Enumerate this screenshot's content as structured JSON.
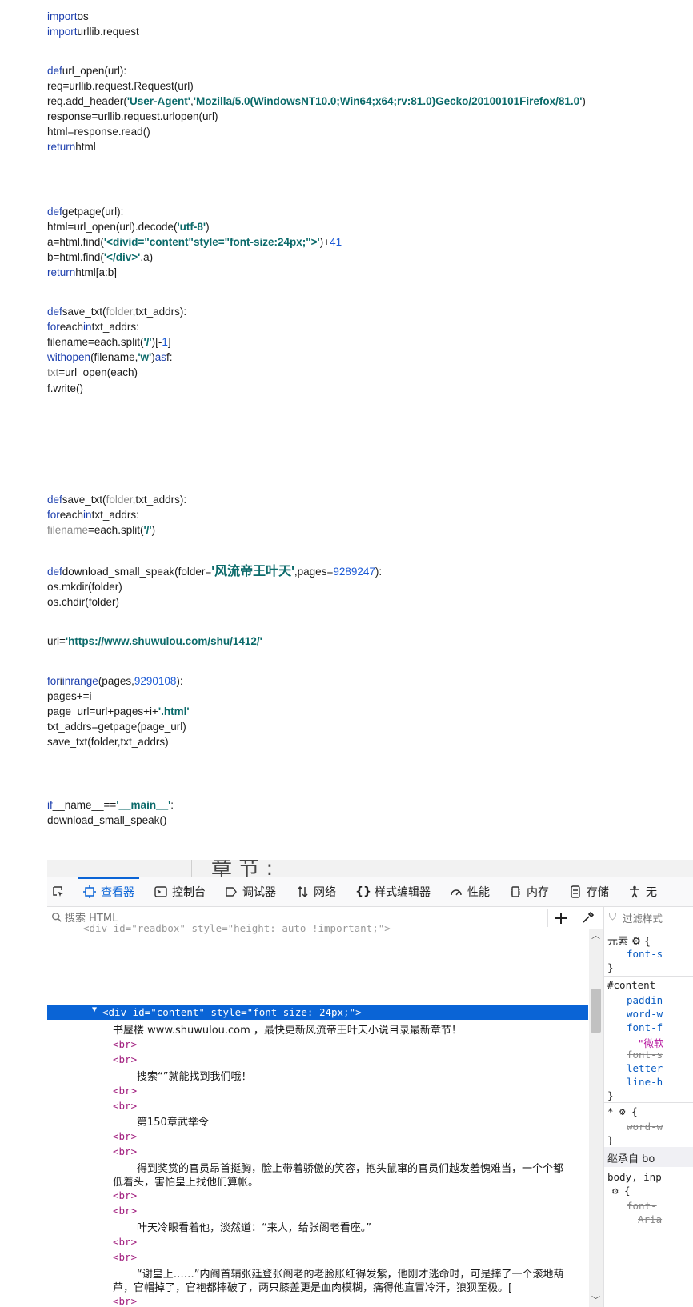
{
  "code": {
    "l1": {
      "kw": "import",
      "rest": "os"
    },
    "l2": {
      "kw": "import",
      "rest": "urllib.request"
    },
    "l3": {
      "kw": "def",
      "rest": "url_open(url):"
    },
    "l4": "req=urllib.request.Request(url)",
    "l5": {
      "pre": "req.add_header(",
      "s1": "'User-Agent'",
      "mid": ",",
      "s2": "'Mozilla/5.0(WindowsNT10.0;Win64;x64;rv:81.0)Gecko/20100101Firefox/81.0'",
      "post": ")"
    },
    "l6": "response=urllib.request.urlopen(url)",
    "l7": "html=response.read()",
    "l8": {
      "kw": "return",
      "rest": "html"
    },
    "l9": {
      "kw": "def",
      "rest": "getpage(url):"
    },
    "l10": {
      "pre": "html=url_open(url).decode(",
      "s": "'utf-8'",
      "post": ")"
    },
    "l11": {
      "pre": "a=html.find(",
      "s": "'<divid=\"content\"style=\"font-size:24px;\">'",
      "mid": ")+",
      "n": "41"
    },
    "l12": {
      "pre": "b=html.find(",
      "s": "'</div>'",
      "post": ",a)"
    },
    "l13": {
      "kw": "return",
      "rest": "html[a:b]"
    },
    "l14": {
      "kw": "def",
      "rest1": "save_txt(",
      "g": "folder",
      "rest2": ",txt_addrs):"
    },
    "l15": {
      "kw1": "for",
      "mid": "each",
      "kw2": "in",
      "rest": "txt_addrs:"
    },
    "l16": {
      "pre": "filename=each.split(",
      "s": "'/'",
      "mid": ")[-",
      "n": "1",
      "post": "]"
    },
    "l17": {
      "kw1": "with",
      "kw2": "open",
      "pre": "(filename,",
      "s": "'w'",
      "mid": ")",
      "kw3": "as",
      "post": "f:"
    },
    "l18": {
      "g": "txt",
      "rest": "=url_open(each)"
    },
    "l19": "f.write()",
    "l20": {
      "kw": "def",
      "rest1": "save_txt(",
      "g": "folder",
      "rest2": ",txt_addrs):"
    },
    "l21": {
      "kw1": "for",
      "mid": "each",
      "kw2": "in",
      "rest": "txt_addrs:"
    },
    "l22": {
      "g": "filename",
      "pre": "=each.split(",
      "s": "'/'",
      "post": ")"
    },
    "l23": {
      "kw": "def",
      "pre": "download_small_speak(folder=",
      "s": "'风流帝王叶天'",
      "mid": ",pages=",
      "n": "9289247",
      "post": "):"
    },
    "l24": "os.mkdir(folder)",
    "l25": "os.chdir(folder)",
    "l26": {
      "pre": "url=",
      "s": "'https://www.shuwulou.com/shu/1412/'"
    },
    "l27": {
      "kw1": "for",
      "mid": "i",
      "kw2": "in",
      "kw3": "range",
      "pre": "(pages,",
      "n": "9290108",
      "post": "):"
    },
    "l28": "pages+=i",
    "l29": {
      "pre": "page_url=url+pages+i+",
      "s": "'.html'"
    },
    "l30": "txt_addrs=getpage(page_url)",
    "l31": "save_txt(folder,txt_addrs)",
    "l32": {
      "kw": "if",
      "pre": "__name__==",
      "s": "'__main__'",
      "post": ":"
    },
    "l33": "download_small_speak()"
  },
  "devtools": {
    "page_fragment": "章 节 :",
    "tabs": [
      {
        "label": "查看器"
      },
      {
        "label": "控制台"
      },
      {
        "label": "调试器"
      },
      {
        "label": "网络"
      },
      {
        "label": "样式编辑器"
      },
      {
        "label": "性能"
      },
      {
        "label": "内存"
      },
      {
        "label": "存储"
      },
      {
        "label": "无"
      }
    ],
    "search_placeholder": "搜索 HTML",
    "filter_placeholder": "过滤样式",
    "tree": {
      "top_partial": "<div id=\"readbox\" style=\"height: auto !important;\">",
      "selected_tag_open": "<div",
      "selected_attr": "id=",
      "selected_val": "\"content\"",
      "selected_attr2": "style=",
      "selected_val2": "\"font-size: 24px;\"",
      "selected_close": ">",
      "br": "<br>",
      "t1": "书屋楼 www.shuwulou.com ，最快更新风流帝王叶天小说目录最新章节！",
      "t2": "搜索“”就能找到我们哦！",
      "t3": "第150章武举令",
      "t4a": "得到奖赏的官员昂首挺胸，脸上带着骄傲的笑容，抱头鼠窜的官员们越发羞愧难当，一个个都",
      "t4b": "低着头，害怕皇上找他们算帐。",
      "t5": "叶天冷眼看着他，淡然道：“来人，给张阁老看座。”",
      "t6a": "“谢皇上……”内阁首辅张廷登张阁老的老脸胀红得发紫，他刚才逃命时，可是摔了一个滚地葫",
      "t6b": "芦，官帽掉了，官袍都摔破了，两只膝盖更是血肉模糊，痛得他直冒冷汗，狼狈至极。["
    },
    "rules": {
      "r1": "元素 ⚙ {",
      "r2": "font-s",
      "r3": "}",
      "r4": "#content",
      "r5": "paddin",
      "r6": "word-w",
      "r7": "font-f",
      "r8": "\"微软",
      "r9": "font-s",
      "r10": "letter",
      "r11": "line-h",
      "r12": "}",
      "r13": "* ⚙ {",
      "r14": "word-w",
      "r15": "}",
      "r16": "继承自 bo",
      "r17": "body, inp",
      "r18": "⚙ {",
      "r19": "font-",
      "r20": "Aria"
    }
  }
}
